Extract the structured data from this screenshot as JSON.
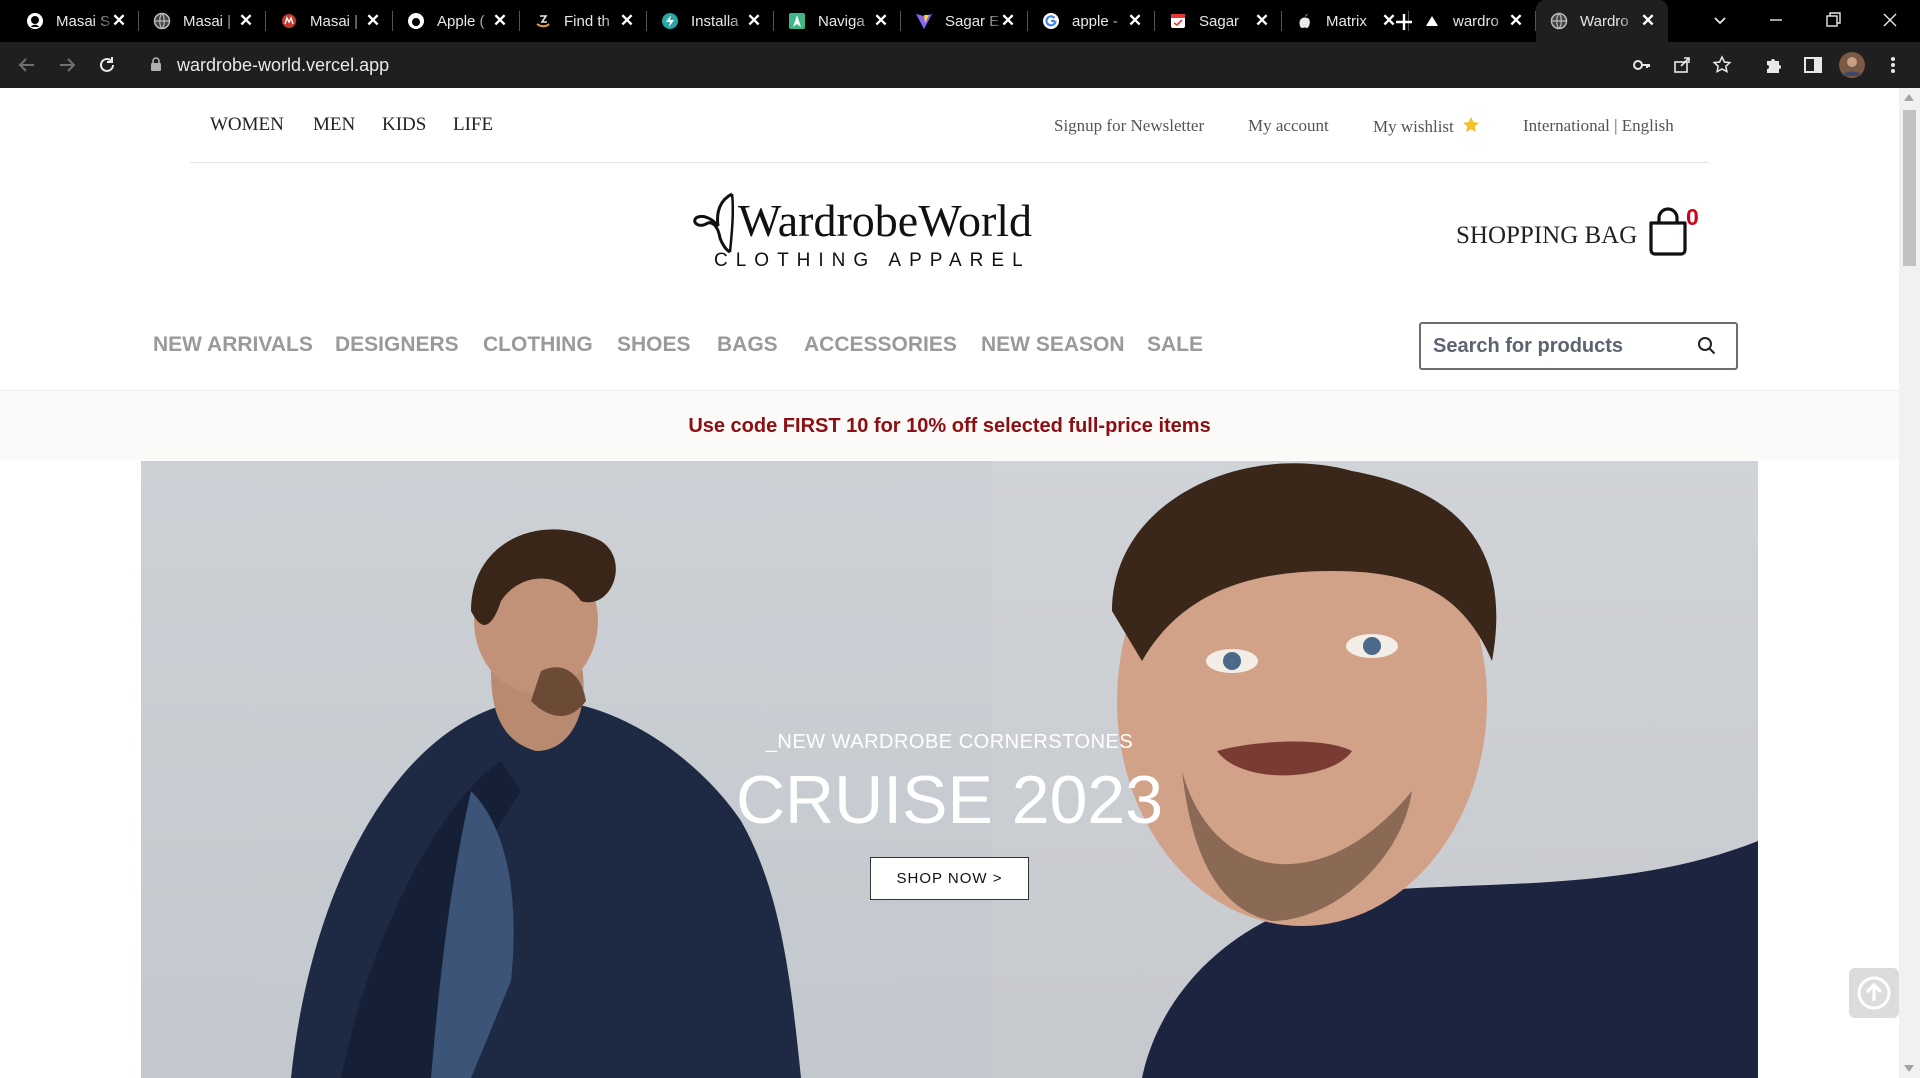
{
  "browser": {
    "tabs": [
      {
        "title": "Masai S",
        "icon": "github-icon"
      },
      {
        "title": "Masai |",
        "icon": "globe-icon"
      },
      {
        "title": "Masai |",
        "icon": "masai-icon"
      },
      {
        "title": "Apple (",
        "icon": "apple-circle-icon"
      },
      {
        "title": "Find th",
        "icon": "amazon-icon"
      },
      {
        "title": "Installa",
        "icon": "bolt-icon"
      },
      {
        "title": "Naviga",
        "icon": "nav-icon"
      },
      {
        "title": "Sagar E",
        "icon": "vite-icon"
      },
      {
        "title": "apple -",
        "icon": "google-icon"
      },
      {
        "title": "Sagar",
        "icon": "calendar-icon"
      },
      {
        "title": "Matrix",
        "icon": "apple-icon"
      },
      {
        "title": "wardro",
        "icon": "vercel-icon"
      },
      {
        "title": "Wardro",
        "icon": "globe-icon",
        "active": true
      }
    ],
    "url": "wardrobe-world.vercel.app"
  },
  "header": {
    "top_nav": [
      "WOMEN",
      "MEN",
      "KIDS",
      "LIFE"
    ],
    "newsletter": "Signup for Newsletter",
    "account": "My account",
    "wishlist": "My wishlist",
    "region": "International | English"
  },
  "logo": {
    "name": "WardrobeWorld",
    "tagline": "CLOTHING APPAREL"
  },
  "bag": {
    "label": "SHOPPING BAG",
    "count": "0"
  },
  "categories": [
    "NEW ARRIVALS",
    "DESIGNERS",
    "CLOTHING",
    "SHOES",
    "BAGS",
    "ACCESSORIES",
    "NEW SEASON",
    "SALE"
  ],
  "search": {
    "placeholder": "Search for products",
    "value": ""
  },
  "promo": {
    "text": "Use code FIRST 10 for 10% off selected full-price items",
    "color": "#8b0e12"
  },
  "hero": {
    "kicker": "_NEW WARDROBE CORNERSTONES",
    "title": "CRUISE 2023",
    "cta": "SHOP NOW >"
  }
}
